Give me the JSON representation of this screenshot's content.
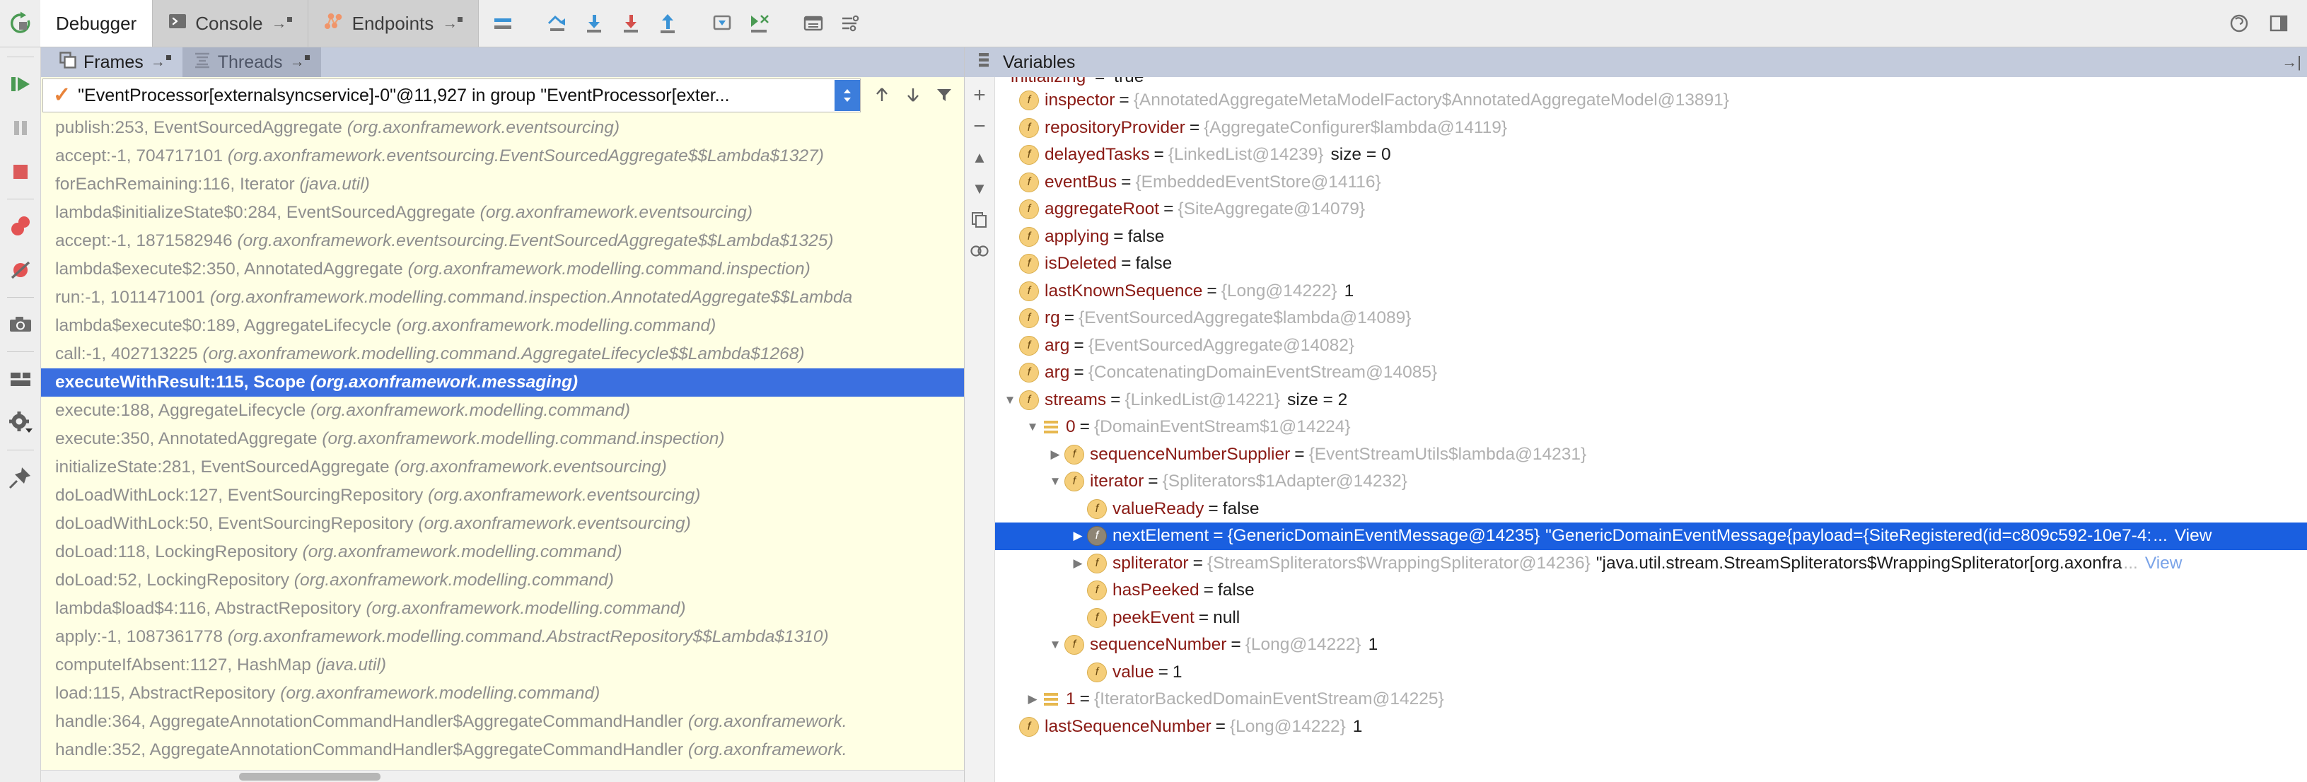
{
  "window": {
    "topbar": {
      "rerun_icon": "rerun-icon",
      "tabs": [
        {
          "label": "Debugger",
          "icon": "",
          "pin": "→",
          "active": true
        },
        {
          "label": "Console",
          "icon": "console-icon",
          "pin": "→",
          "active": false
        },
        {
          "label": "Endpoints",
          "icon": "endpoints-icon",
          "pin": "→",
          "active": false
        }
      ],
      "tools": [
        "show-execution-point-icon",
        "step-over-icon",
        "step-into-icon",
        "force-step-into-icon",
        "step-out-icon",
        "drop-frame-icon",
        "run-to-cursor-icon",
        "evaluate-expression-icon",
        "settings-layout-icon"
      ],
      "right_tools": [
        "help-icon",
        "layout-icon"
      ]
    }
  },
  "rail": {
    "items": [
      "resume-program-icon",
      "pause-program-icon",
      "stop-icon",
      "view-breakpoints-icon",
      "mute-breakpoints-icon",
      "camera-icon",
      "restore-layout-icon",
      "settings-gear-icon",
      "pin-icon"
    ]
  },
  "frames": {
    "header_tabs": [
      {
        "label": "Frames",
        "icon": "frames-icon",
        "pin": "→",
        "active": true
      },
      {
        "label": "Threads",
        "icon": "threads-icon",
        "pin": "→",
        "active": false
      }
    ],
    "thread_selector": {
      "value": "\"EventProcessor[externalsyncservice]-0\"@11,927 in group \"EventProcessor[exter...",
      "check_icon": "check-icon",
      "dropdown_icon": "chevron-updown-icon"
    },
    "frame_tools": [
      "up-arrow-icon",
      "down-arrow-icon",
      "filter-icon"
    ],
    "rows": [
      {
        "text": "publish:253, EventSourcedAggregate ",
        "pkg": "(org.axonframework.eventsourcing)",
        "selected": false
      },
      {
        "text": "accept:-1, 704717101 ",
        "pkg": "(org.axonframework.eventsourcing.EventSourcedAggregate$$Lambda$1327)",
        "selected": false
      },
      {
        "text": "forEachRemaining:116, Iterator ",
        "pkg": "(java.util)",
        "selected": false
      },
      {
        "text": "lambda$initializeState$0:284, EventSourcedAggregate ",
        "pkg": "(org.axonframework.eventsourcing)",
        "selected": false
      },
      {
        "text": "accept:-1, 1871582946 ",
        "pkg": "(org.axonframework.eventsourcing.EventSourcedAggregate$$Lambda$1325)",
        "selected": false
      },
      {
        "text": "lambda$execute$2:350, AnnotatedAggregate ",
        "pkg": "(org.axonframework.modelling.command.inspection)",
        "selected": false
      },
      {
        "text": "run:-1, 1011471001 ",
        "pkg": "(org.axonframework.modelling.command.inspection.AnnotatedAggregate$$Lambda",
        "selected": false
      },
      {
        "text": "lambda$execute$0:189, AggregateLifecycle ",
        "pkg": "(org.axonframework.modelling.command)",
        "selected": false
      },
      {
        "text": "call:-1, 402713225 ",
        "pkg": "(org.axonframework.modelling.command.AggregateLifecycle$$Lambda$1268)",
        "selected": false
      },
      {
        "text": "executeWithResult:115, Scope ",
        "pkg": "(org.axonframework.messaging)",
        "selected": true
      },
      {
        "text": "execute:188, AggregateLifecycle ",
        "pkg": "(org.axonframework.modelling.command)",
        "selected": false
      },
      {
        "text": "execute:350, AnnotatedAggregate ",
        "pkg": "(org.axonframework.modelling.command.inspection)",
        "selected": false
      },
      {
        "text": "initializeState:281, EventSourcedAggregate ",
        "pkg": "(org.axonframework.eventsourcing)",
        "selected": false
      },
      {
        "text": "doLoadWithLock:127, EventSourcingRepository ",
        "pkg": "(org.axonframework.eventsourcing)",
        "selected": false
      },
      {
        "text": "doLoadWithLock:50, EventSourcingRepository ",
        "pkg": "(org.axonframework.eventsourcing)",
        "selected": false
      },
      {
        "text": "doLoad:118, LockingRepository ",
        "pkg": "(org.axonframework.modelling.command)",
        "selected": false
      },
      {
        "text": "doLoad:52, LockingRepository ",
        "pkg": "(org.axonframework.modelling.command)",
        "selected": false
      },
      {
        "text": "lambda$load$4:116, AbstractRepository ",
        "pkg": "(org.axonframework.modelling.command)",
        "selected": false
      },
      {
        "text": "apply:-1, 1087361778 ",
        "pkg": "(org.axonframework.modelling.command.AbstractRepository$$Lambda$1310)",
        "selected": false
      },
      {
        "text": "computeIfAbsent:1127, HashMap ",
        "pkg": "(java.util)",
        "selected": false
      },
      {
        "text": "load:115, AbstractRepository ",
        "pkg": "(org.axonframework.modelling.command)",
        "selected": false
      },
      {
        "text": "handle:364, AggregateAnnotationCommandHandler$AggregateCommandHandler ",
        "pkg": "(org.axonframework.",
        "selected": false
      },
      {
        "text": "handle:352, AggregateAnnotationCommandHandler$AggregateCommandHandler ",
        "pkg": "(org.axonframework.",
        "selected": false
      }
    ]
  },
  "variables": {
    "title": "Variables",
    "title_icon": "variables-icon",
    "rail_buttons": [
      "add-watch-icon",
      "remove-watch-icon",
      "up-icon",
      "down-icon",
      "copy-icon",
      "inspect-icon"
    ],
    "cut_row": {
      "name": "initializing",
      "eq": "=",
      "value": "true"
    },
    "rows": [
      {
        "indent": 0,
        "tri": "none",
        "badge": "f",
        "badge_style": "field",
        "name": "inspector",
        "eq": "=",
        "value": "{AnnotatedAggregateMetaModelFactory$AnnotatedAggregateModel@13891}",
        "extra": "",
        "selected": false
      },
      {
        "indent": 0,
        "tri": "none",
        "badge": "f",
        "badge_style": "field",
        "name": "repositoryProvider",
        "eq": "=",
        "value": "{AggregateConfigurer$lambda@14119}",
        "extra": "",
        "selected": false
      },
      {
        "indent": 0,
        "tri": "none",
        "badge": "f",
        "badge_style": "field",
        "name": "delayedTasks",
        "eq": "=",
        "value": "{LinkedList@14239}",
        "extra": "size = 0",
        "selected": false
      },
      {
        "indent": 0,
        "tri": "none",
        "badge": "f",
        "badge_style": "field",
        "name": "eventBus",
        "eq": "=",
        "value": "{EmbeddedEventStore@14116}",
        "extra": "",
        "selected": false
      },
      {
        "indent": 0,
        "tri": "none",
        "badge": "f",
        "badge_style": "field",
        "name": "aggregateRoot",
        "eq": "=",
        "value": "{SiteAggregate@14079}",
        "extra": "",
        "selected": false
      },
      {
        "indent": 0,
        "tri": "none",
        "badge": "f",
        "badge_style": "field",
        "name": "applying",
        "eq": "=",
        "value": "false",
        "value_plain": true,
        "extra": "",
        "selected": false
      },
      {
        "indent": 0,
        "tri": "none",
        "badge": "f",
        "badge_style": "field",
        "name": "isDeleted",
        "eq": "=",
        "value": "false",
        "value_plain": true,
        "extra": "",
        "selected": false
      },
      {
        "indent": 0,
        "tri": "none",
        "badge": "f",
        "badge_style": "field",
        "name": "lastKnownSequence",
        "eq": "=",
        "value": "{Long@14222}",
        "extra": "1",
        "selected": false
      },
      {
        "indent": 0,
        "tri": "none",
        "badge": "f",
        "badge_style": "field",
        "name": "rg",
        "eq": "=",
        "value": "{EventSourcedAggregate$lambda@14089}",
        "extra": "",
        "selected": false
      },
      {
        "indent": 0,
        "tri": "none",
        "badge": "f",
        "badge_style": "field",
        "name": "arg",
        "eq": "=",
        "value": "{EventSourcedAggregate@14082}",
        "extra": "",
        "selected": false
      },
      {
        "indent": 0,
        "tri": "none",
        "badge": "f",
        "badge_style": "field",
        "name": "arg",
        "eq": "=",
        "value": "{ConcatenatingDomainEventStream@14085}",
        "extra": "",
        "selected": false
      },
      {
        "indent": 0,
        "tri": "down",
        "badge": "f",
        "badge_style": "field",
        "name": "streams",
        "eq": "=",
        "value": "{LinkedList@14221}",
        "extra": "size = 2",
        "selected": false
      },
      {
        "indent": 1,
        "tri": "down",
        "badge": "list",
        "badge_style": "list",
        "name": "0",
        "eq": "=",
        "value": "{DomainEventStream$1@14224}",
        "extra": "",
        "selected": false
      },
      {
        "indent": 2,
        "tri": "right",
        "badge": "f",
        "badge_style": "field",
        "name": "sequenceNumberSupplier",
        "eq": "=",
        "value": "{EventStreamUtils$lambda@14231}",
        "extra": "",
        "selected": false
      },
      {
        "indent": 2,
        "tri": "down",
        "badge": "f",
        "badge_style": "field",
        "name": "iterator",
        "eq": "=",
        "value": "{Spliterators$1Adapter@14232}",
        "extra": "",
        "selected": false
      },
      {
        "indent": 3,
        "tri": "none",
        "badge": "f",
        "badge_style": "field",
        "name": "valueReady",
        "eq": "=",
        "value": "false",
        "value_plain": true,
        "extra": "",
        "selected": false
      },
      {
        "indent": 3,
        "tri": "right",
        "badge": "f",
        "badge_style": "grey",
        "name": "nextElement",
        "eq": "=",
        "value": "{GenericDomainEventMessage@14235}",
        "string": "\"GenericDomainEventMessage{payload={SiteRegistered(id=c809c592-10e7-4:",
        "ellipsis": "...",
        "view": "View",
        "selected": true
      },
      {
        "indent": 3,
        "tri": "right",
        "badge": "f",
        "badge_style": "field",
        "name": "spliterator",
        "eq": "=",
        "value": "{StreamSpliterators$WrappingSpliterator@14236}",
        "string": "\"java.util.stream.StreamSpliterators$WrappingSpliterator[org.axonfra",
        "ellipsis": "...",
        "view": "View",
        "selected": false
      },
      {
        "indent": 3,
        "tri": "none",
        "badge": "f",
        "badge_style": "field",
        "name": "hasPeeked",
        "eq": "=",
        "value": "false",
        "value_plain": true,
        "extra": "",
        "selected": false
      },
      {
        "indent": 3,
        "tri": "none",
        "badge": "f",
        "badge_style": "field",
        "name": "peekEvent",
        "eq": "=",
        "value": "null",
        "value_plain": true,
        "extra": "",
        "selected": false
      },
      {
        "indent": 2,
        "tri": "down",
        "badge": "f",
        "badge_style": "field",
        "name": "sequenceNumber",
        "eq": "=",
        "value": "{Long@14222}",
        "extra": "1",
        "selected": false
      },
      {
        "indent": 3,
        "tri": "none",
        "badge": "f",
        "badge_style": "field",
        "name": "value",
        "eq": "=",
        "value": "1",
        "value_plain": true,
        "extra": "",
        "selected": false
      },
      {
        "indent": 1,
        "tri": "right",
        "badge": "list",
        "badge_style": "list",
        "name": "1",
        "eq": "=",
        "value": "{IteratorBackedDomainEventStream@14225}",
        "extra": "",
        "selected": false
      },
      {
        "indent": 0,
        "tri": "none",
        "badge": "f",
        "badge_style": "field",
        "name": "lastSequenceNumber",
        "eq": "=",
        "value": "{Long@14222}",
        "extra": "1",
        "selected": false
      }
    ]
  },
  "colors": {
    "selection_blue": "#3b6fe0",
    "var_selection_blue": "#1a5fe0",
    "frames_bg": "#ffffe4",
    "pane_header": "#c3cbdc",
    "var_name_red": "#8a1a14",
    "accent_orange": "#e8833a"
  }
}
